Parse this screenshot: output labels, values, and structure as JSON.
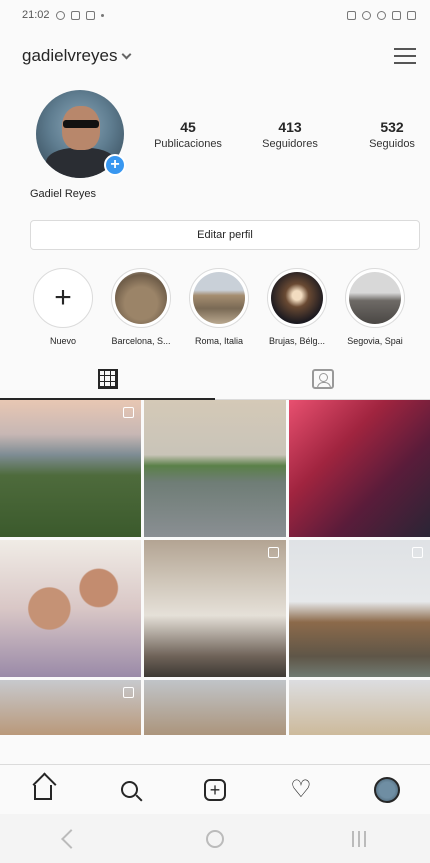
{
  "status_bar": {
    "time": "21:02"
  },
  "header": {
    "username": "gadielvreyes"
  },
  "profile": {
    "full_name": "Gadiel Reyes",
    "stats": [
      {
        "value": "45",
        "label": "Publicaciones"
      },
      {
        "value": "413",
        "label": "Seguidores"
      },
      {
        "value": "532",
        "label": "Seguidos"
      }
    ],
    "edit_button": "Editar perfil"
  },
  "highlights": [
    {
      "label": "Nuevo",
      "type": "add"
    },
    {
      "label": "Barcelona, S...",
      "color": "#8a7560"
    },
    {
      "label": "Roma, Italia",
      "color": "#9c8a70"
    },
    {
      "label": "Brujas, Bélg...",
      "color": "#2b2a30"
    },
    {
      "label": "Segovia, Spai",
      "color": "#6e6a66"
    }
  ],
  "photos": [
    {
      "multiple": true
    },
    {
      "multiple": false
    },
    {
      "multiple": false
    },
    {
      "multiple": false
    },
    {
      "multiple": true
    },
    {
      "multiple": true
    },
    {
      "multiple": true
    },
    {
      "multiple": false
    },
    {
      "multiple": false
    }
  ]
}
